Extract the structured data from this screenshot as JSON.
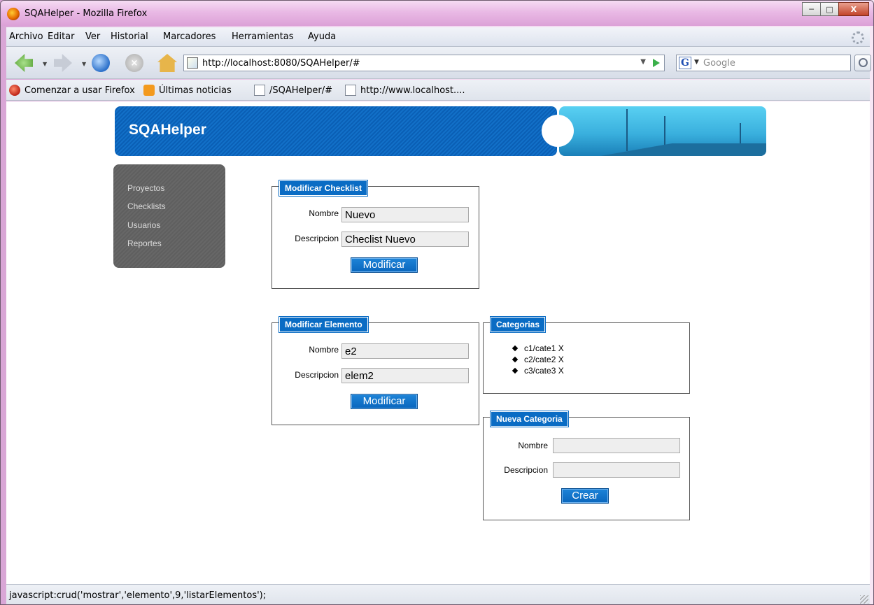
{
  "window": {
    "title": "SQAHelper - Mozilla Firefox"
  },
  "menu": [
    "Archivo",
    "Editar",
    "Ver",
    "Historial",
    "Marcadores",
    "Herramientas",
    "Ayuda"
  ],
  "nav": {
    "url": "http://localhost:8080/SQAHelper/#",
    "search_placeholder": "Google"
  },
  "bookmarks": [
    "Comenzar a usar Firefox",
    "Últimas noticias",
    "/SQAHelper/#",
    "http://www.localhost...."
  ],
  "app": {
    "brand": "SQAHelper"
  },
  "sidebar": {
    "items": [
      "Proyectos",
      "Checklists",
      "Usuarios",
      "Reportes"
    ]
  },
  "checklist_form": {
    "legend": "Modificar Checklist",
    "nombre_label": "Nombre",
    "nombre_value": "Nuevo",
    "descripcion_label": "Descripcion",
    "descripcion_value": "Checlist Nuevo",
    "button": "Modificar"
  },
  "elemento_form": {
    "legend": "Modificar Elemento",
    "nombre_label": "Nombre",
    "nombre_value": "e2",
    "descripcion_label": "Descripcion",
    "descripcion_value": "elem2",
    "button": "Modificar"
  },
  "categorias": {
    "legend": "Categorias",
    "items": [
      "c1/cate1 X",
      "c2/cate2 X",
      "c3/cate3 X"
    ]
  },
  "nueva_categoria": {
    "legend": "Nueva Categoria",
    "nombre_label": "Nombre",
    "nombre_value": "",
    "descripcion_label": "Descripcion",
    "descripcion_value": "",
    "button": "Crear"
  },
  "status": {
    "text": "javascript:crud('mostrar','elemento',9,'listarElementos');"
  }
}
